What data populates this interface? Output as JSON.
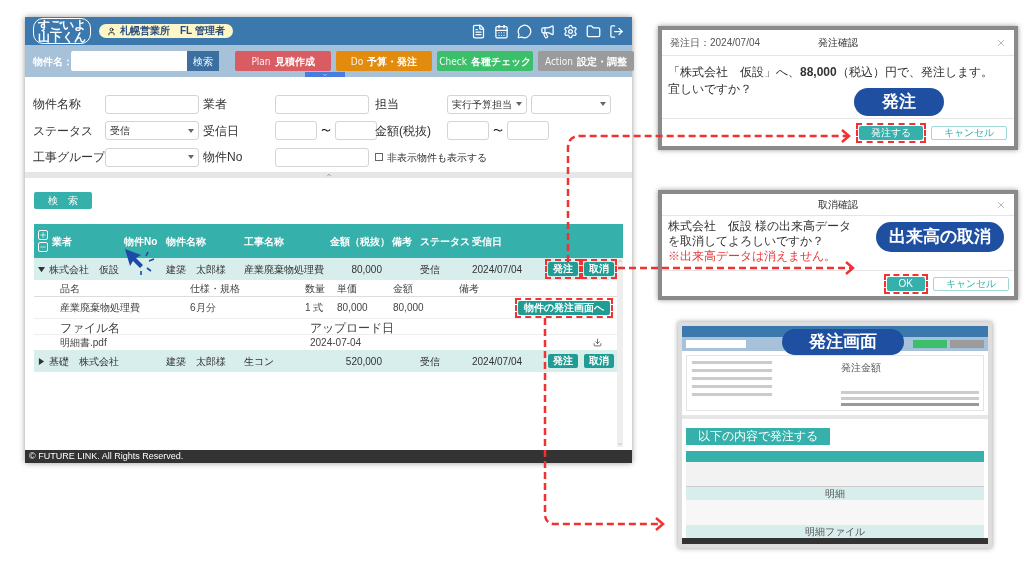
{
  "main_screen": {
    "logo": [
      "すごいよ",
      "山下くん"
    ],
    "user_badge": "札幌営業所　FL 管理者",
    "search": {
      "label": "物件名：",
      "button": "検索"
    },
    "phases": [
      {
        "en": "Plan",
        "ja": "見積作成",
        "color": "#d95c62"
      },
      {
        "en": "Do",
        "ja": "予算・発注",
        "color": "#e38b0c"
      },
      {
        "en": "Check",
        "ja": "各種チェック",
        "color": "#3cbf6b"
      },
      {
        "en": "Action",
        "ja": "設定・調整",
        "color": "#9b9b9b"
      }
    ],
    "filters": [
      {
        "label": "物件名称",
        "kind": "text"
      },
      {
        "label": "業者",
        "kind": "text"
      },
      {
        "label": "担当",
        "kind": "select_pair",
        "value": "実行予算担当"
      },
      {
        "label": "ステータス",
        "kind": "select",
        "value": "受信"
      },
      {
        "label": "受信日",
        "kind": "range",
        "separator": "〜"
      },
      {
        "label": "金額(税抜)",
        "kind": "range",
        "separator": "〜"
      },
      {
        "label": "工事グループ",
        "kind": "select"
      },
      {
        "label": "物件No",
        "kind": "text"
      },
      {
        "label": "非表示物件も表示する",
        "kind": "checkbox",
        "checked": false
      }
    ],
    "search_button": "検　索",
    "table": {
      "columns": [
        "業者",
        "物件No",
        "物件名称",
        "工事名称",
        "金額（税抜）",
        "備考",
        "ステータス",
        "受信日"
      ],
      "rows": [
        {
          "cells": [
            "株式会社　仮設",
            "",
            "建築　太郎様",
            "産業廃棄物処理費",
            "80,000",
            "",
            "受信",
            "2024/07/04"
          ],
          "expanded": true,
          "actions": [
            {
              "label": "発注",
              "highlighted": true
            },
            {
              "label": "取消",
              "highlighted": true
            }
          ],
          "detail": {
            "item_columns": [
              "品名",
              "仕様・規格",
              "数量",
              "単価",
              "金額",
              "備考"
            ],
            "items": [
              [
                "産業廃棄物処理費",
                "6月分",
                "1 式",
                "80,000",
                "80,000"
              ]
            ],
            "order_button": {
              "label": "物件の発注画面へ",
              "highlighted": true
            },
            "file_columns": [
              "ファイル名",
              "アップロード日"
            ],
            "files": [
              [
                "明細書.pdf",
                "2024-07-04"
              ]
            ]
          }
        },
        {
          "cells": [
            "基礎　株式会社",
            "",
            "建築　太郎様",
            "生コン",
            "520,000",
            "",
            "受信",
            "2024/07/04"
          ],
          "expanded": false,
          "actions": [
            {
              "label": "発注",
              "highlighted": false
            },
            {
              "label": "取消",
              "highlighted": false
            }
          ]
        }
      ]
    },
    "footer": "© FUTURE LINK. All Rights Reserved."
  },
  "order_dialog": {
    "date": "発注日：2024/07/04",
    "title": "発注確認",
    "message": "「株式会社　仮設」へ、**88,000**（税込）円で、発注します。",
    "question": "宜しいですか？",
    "buttons": [
      {
        "label": "発注する",
        "kind": "primary",
        "highlighted": true
      },
      {
        "label": "キャンセル",
        "kind": "secondary",
        "highlighted": false
      }
    ],
    "callout": "発注"
  },
  "cancel_dialog": {
    "title": "取消確認",
    "message": "株式会社　仮設 様の出来高データを取消してよろしいですか？",
    "warning": "※出来高データは消えません。",
    "buttons": [
      {
        "label": "OK",
        "kind": "primary",
        "highlighted": true
      },
      {
        "label": "キャンセル",
        "kind": "secondary",
        "highlighted": false
      }
    ],
    "callout": "出来高の取消"
  },
  "order_screen_preview": {
    "callout": "発注画面",
    "summary_title": "発注金額",
    "submit_button": "以下の内容で発注する",
    "sections": [
      "明細",
      "明細ファイル"
    ]
  }
}
